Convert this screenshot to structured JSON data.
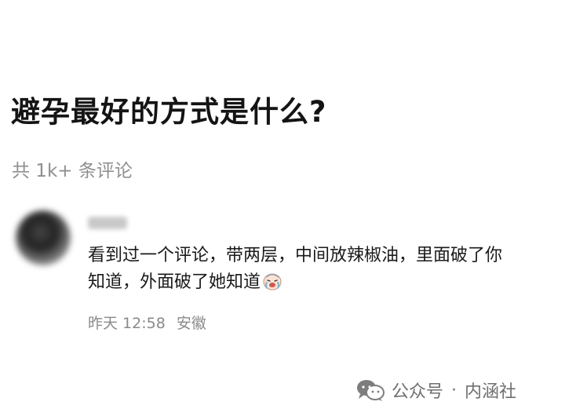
{
  "question": {
    "title": "避孕最好的方式是什么?"
  },
  "comments_summary": {
    "count_text": "共 1k+ 条评论"
  },
  "comment": {
    "text_line1": "看到过一个评论，带两层，中间放辣椒油，里面破了你",
    "text_line2": "知道，外面破了她知道",
    "emoji": "crying-laughing-emoji",
    "time": "昨天 12:58",
    "location": "安徽"
  },
  "watermark": {
    "icon": "wechat-icon",
    "account_type": "公众号",
    "separator": "·",
    "account_name": "内涵社"
  }
}
